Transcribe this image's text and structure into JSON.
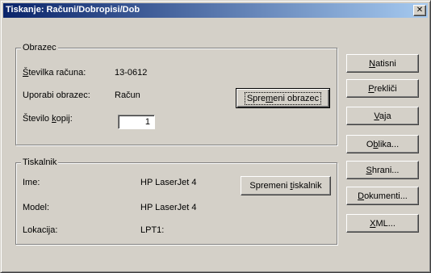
{
  "window": {
    "title": "Tiskanje: Računi/Dobropisi/Dob",
    "close_glyph": "✕"
  },
  "obrazec": {
    "legend": "Obrazec",
    "invoice_number": {
      "label_pre": "",
      "label_u": "Š",
      "label_post": "tevilka računa:",
      "value": "13-0612"
    },
    "form_used": {
      "label": "Uporabi obrazec:",
      "value": "Račun"
    },
    "copies": {
      "label_pre": "Število ",
      "label_u": "k",
      "label_post": "opij:",
      "value": "1"
    },
    "change_form_button": {
      "pre": "Spre",
      "u": "m",
      "post": "eni obrazec"
    }
  },
  "tiskalnik": {
    "legend": "Tiskalnik",
    "name": {
      "label": "Ime:",
      "value": "HP LaserJet 4"
    },
    "model": {
      "label": "Model:",
      "value": "HP LaserJet 4"
    },
    "location": {
      "label": "Lokacija:",
      "value": "LPT1:"
    },
    "change_printer_button": {
      "pre": "Spremeni ",
      "u": "t",
      "post": "iskalnik"
    }
  },
  "buttons": [
    {
      "pre": "",
      "u": "N",
      "post": "atisni"
    },
    {
      "pre": "",
      "u": "P",
      "post": "rekliči"
    },
    {
      "pre": "",
      "u": "V",
      "post": "aja"
    },
    {
      "pre": "O",
      "u": "b",
      "post": "lika..."
    },
    {
      "pre": "",
      "u": "S",
      "post": "hrani..."
    },
    {
      "pre": "",
      "u": "D",
      "post": "okumenti..."
    },
    {
      "pre": "",
      "u": "X",
      "post": "ML..."
    }
  ]
}
